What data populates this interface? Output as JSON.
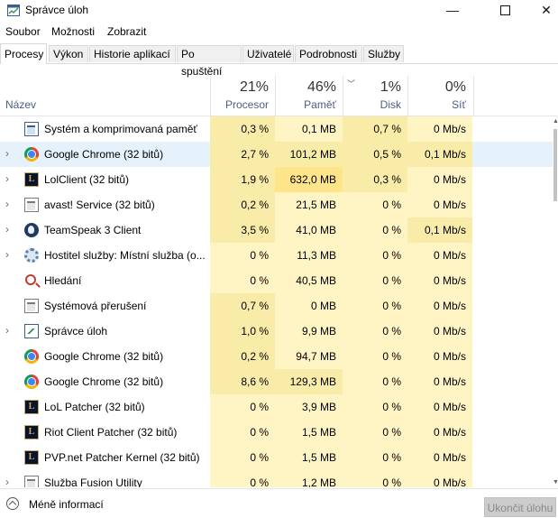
{
  "window": {
    "title": "Správce úloh",
    "minimize_glyph": "—",
    "close_glyph": "✕"
  },
  "menu": [
    "Soubor",
    "Možnosti",
    "Zobrazit"
  ],
  "tabs": [
    "Procesy",
    "Výkon",
    "Historie aplikací",
    "Po spuštění",
    "Uživatelé",
    "Podrobnosti",
    "Služby"
  ],
  "active_tab": "Procesy",
  "columns": {
    "name": "Název",
    "cpu": {
      "percent": "21%",
      "label": "Procesor"
    },
    "memory": {
      "percent": "46%",
      "label": "Paměť"
    },
    "disk": {
      "percent": "1%",
      "label": "Disk"
    },
    "network": {
      "percent": "0%",
      "label": "Síť"
    }
  },
  "colors": {
    "heat_light": "#fff4c4",
    "heat_medium": "#f9eca8",
    "heat_strong": "#ffe58a",
    "selection": "#e5f1fb"
  },
  "processes": [
    {
      "name": "Systém a komprimovaná paměť",
      "icon": "window-icon",
      "expandable": false,
      "cpu": "0,3 %",
      "mem": "0,1 MB",
      "disk": "0,7 %",
      "net": "0 Mb/s",
      "selected": false
    },
    {
      "name": "Google Chrome (32 bitů)",
      "icon": "chrome-icon",
      "expandable": true,
      "cpu": "2,7 %",
      "mem": "101,2 MB",
      "disk": "0,5 %",
      "net": "0,1 Mb/s",
      "selected": true
    },
    {
      "name": "LolClient (32 bitů)",
      "icon": "lol-icon",
      "expandable": true,
      "cpu": "1,9 %",
      "mem": "632,0 MB",
      "disk": "0,3 %",
      "net": "0 Mb/s",
      "selected": false
    },
    {
      "name": "avast! Service (32 bitů)",
      "icon": "window-gray-icon",
      "expandable": true,
      "cpu": "0,2 %",
      "mem": "21,5 MB",
      "disk": "0 %",
      "net": "0 Mb/s",
      "selected": false
    },
    {
      "name": "TeamSpeak 3 Client",
      "icon": "teamspeak-icon",
      "expandable": true,
      "cpu": "3,5 %",
      "mem": "41,0 MB",
      "disk": "0 %",
      "net": "0,1 Mb/s",
      "selected": false
    },
    {
      "name": "Hostitel služby: Místní služba (o...",
      "icon": "gear-icon",
      "expandable": true,
      "cpu": "0 %",
      "mem": "11,3 MB",
      "disk": "0 %",
      "net": "0 Mb/s",
      "selected": false
    },
    {
      "name": "Hledání",
      "icon": "search-icon",
      "expandable": false,
      "cpu": "0 %",
      "mem": "40,5 MB",
      "disk": "0 %",
      "net": "0 Mb/s",
      "selected": false
    },
    {
      "name": "Systémová přerušení",
      "icon": "window-gray-icon",
      "expandable": false,
      "cpu": "0,7 %",
      "mem": "0 MB",
      "disk": "0 %",
      "net": "0 Mb/s",
      "selected": false
    },
    {
      "name": "Správce úloh",
      "icon": "task-manager-icon",
      "expandable": true,
      "cpu": "1,0 %",
      "mem": "9,9 MB",
      "disk": "0 %",
      "net": "0 Mb/s",
      "selected": false
    },
    {
      "name": "Google Chrome (32 bitů)",
      "icon": "chrome-icon",
      "expandable": false,
      "cpu": "0,2 %",
      "mem": "94,7 MB",
      "disk": "0 %",
      "net": "0 Mb/s",
      "selected": false
    },
    {
      "name": "Google Chrome (32 bitů)",
      "icon": "chrome-icon",
      "expandable": false,
      "cpu": "8,6 %",
      "mem": "129,3 MB",
      "disk": "0 %",
      "net": "0 Mb/s",
      "selected": false
    },
    {
      "name": "LoL Patcher (32 bitů)",
      "icon": "lol-icon",
      "expandable": false,
      "cpu": "0 %",
      "mem": "3,9 MB",
      "disk": "0 %",
      "net": "0 Mb/s",
      "selected": false
    },
    {
      "name": "Riot Client Patcher (32 bitů)",
      "icon": "lol-icon",
      "expandable": false,
      "cpu": "0 %",
      "mem": "1,5 MB",
      "disk": "0 %",
      "net": "0 Mb/s",
      "selected": false
    },
    {
      "name": "PVP.net Patcher Kernel (32 bitů)",
      "icon": "lol-icon",
      "expandable": false,
      "cpu": "0 %",
      "mem": "1,5 MB",
      "disk": "0 %",
      "net": "0 Mb/s",
      "selected": false
    },
    {
      "name": "Služba Fusion Utility",
      "icon": "window-gray-icon",
      "expandable": true,
      "cpu": "0 %",
      "mem": "1,2 MB",
      "disk": "0 %",
      "net": "0 Mb/s",
      "selected": false
    }
  ],
  "footer": {
    "fewer_details": "Méně informací",
    "end_task": "Ukončit úlohu"
  }
}
